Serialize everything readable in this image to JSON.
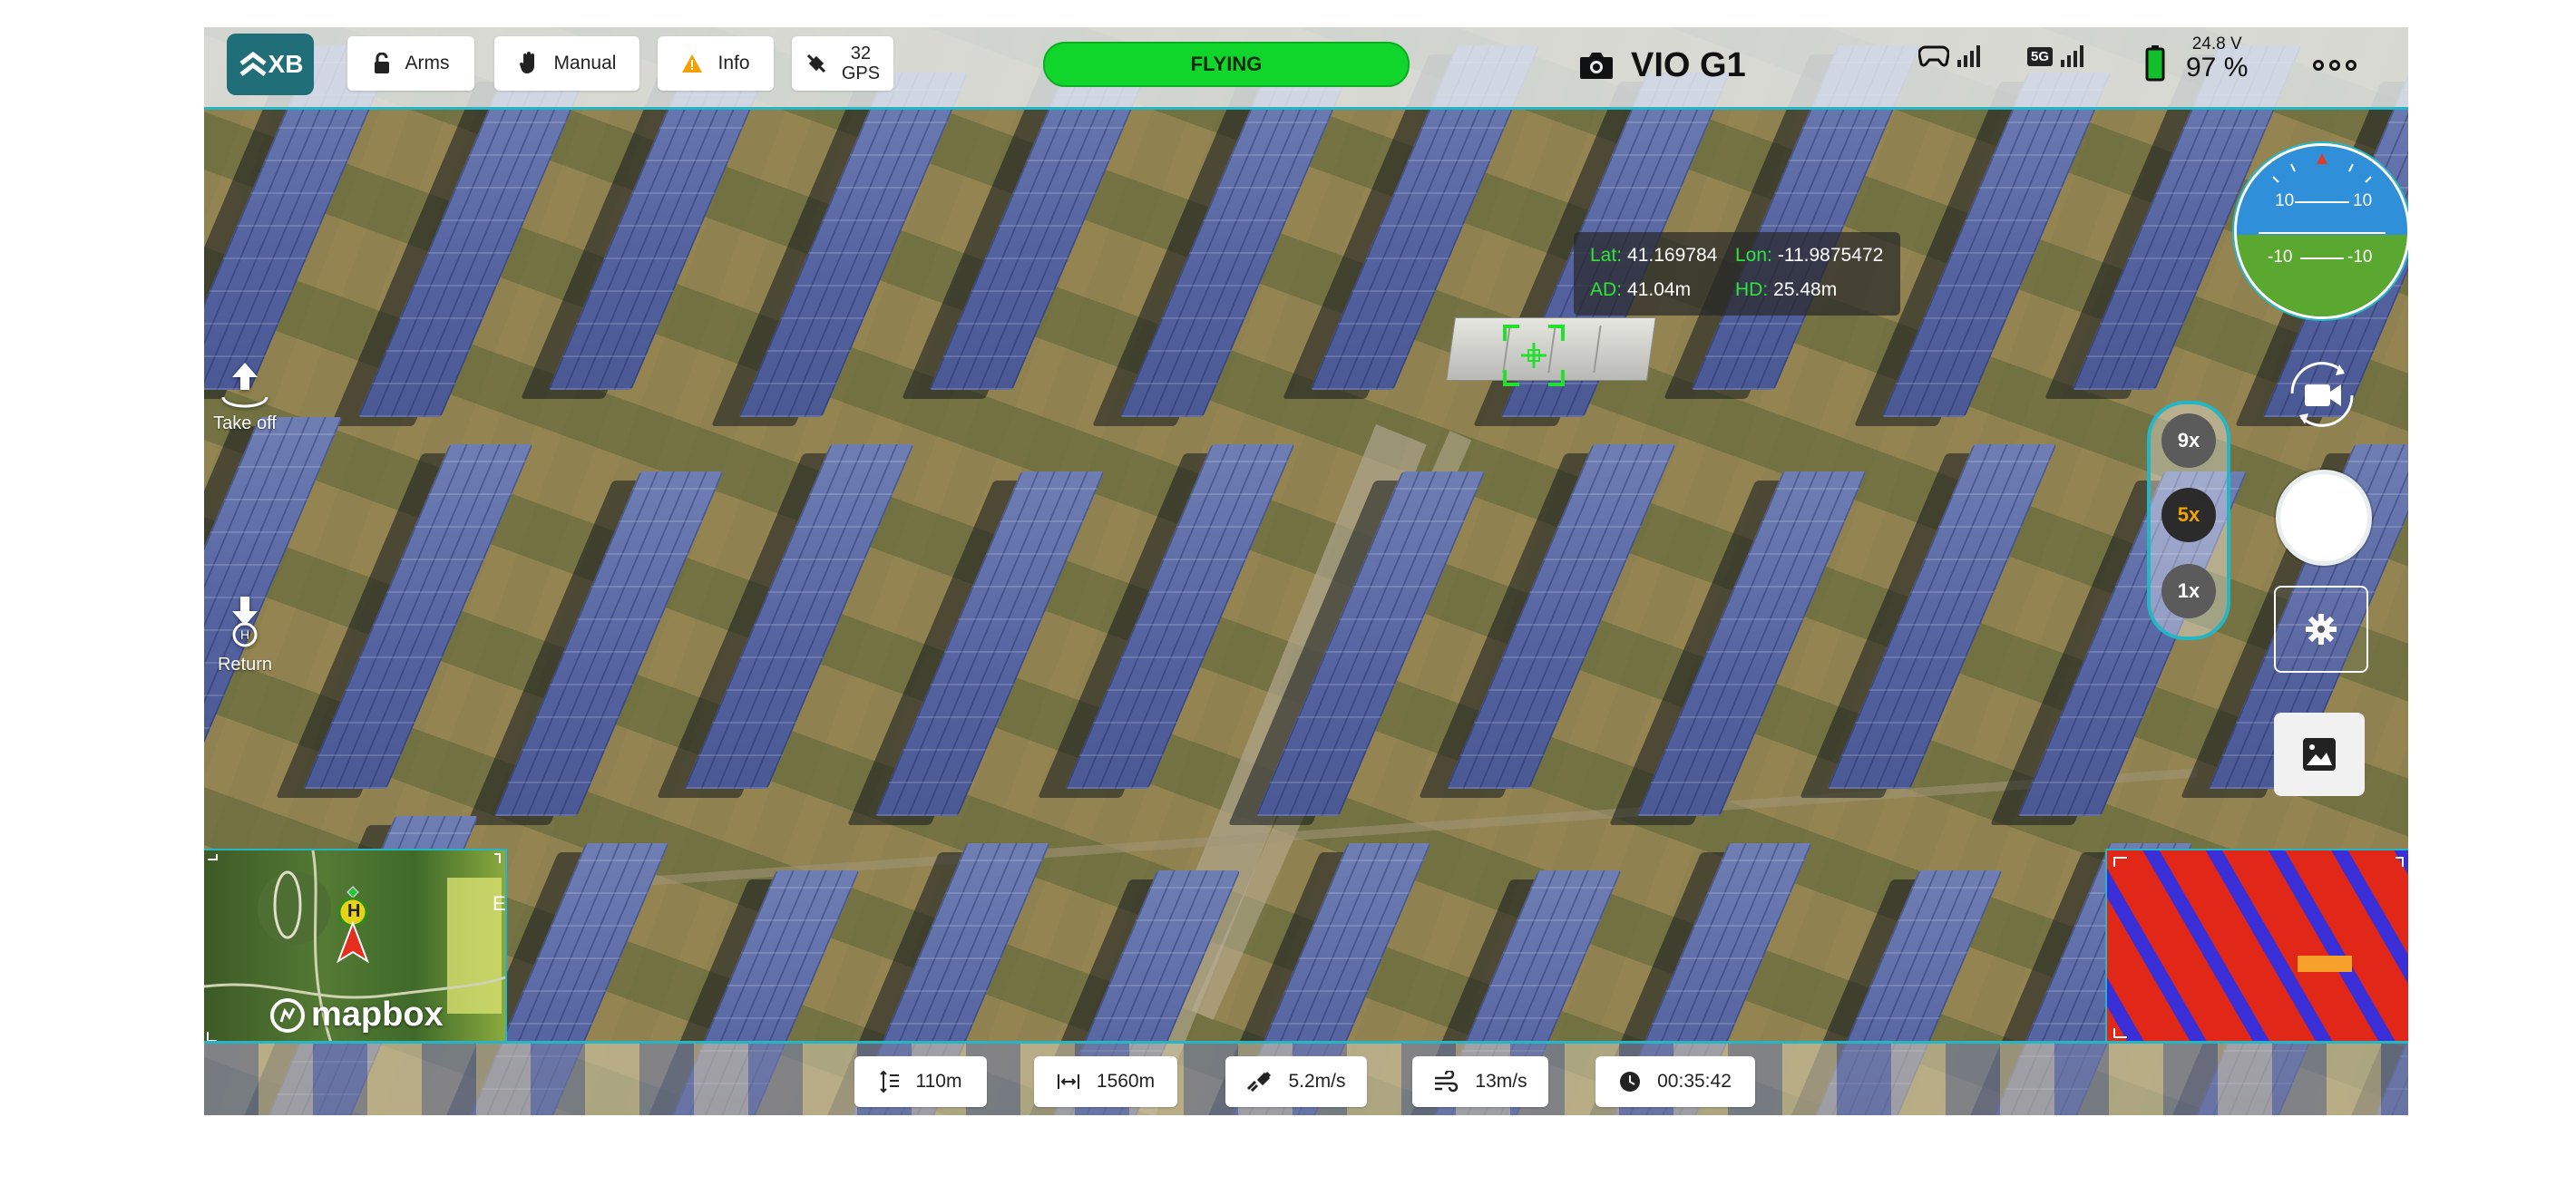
{
  "topbar": {
    "logo_text": "XB",
    "arms_label": "Arms",
    "mode_label": "Manual",
    "info_label": "Info",
    "gps_count": "32",
    "gps_label": "GPS",
    "status": "FLYING",
    "camera_name": "VIO G1",
    "battery_voltage": "24.8 V",
    "battery_percent": "97 %",
    "status_color": "#10d52b",
    "accent_color": "#23b7c5"
  },
  "side": {
    "takeoff_label": "Take off",
    "return_label": "Return"
  },
  "coords": {
    "lat_key": "Lat:",
    "lat_value": "41.169784",
    "lon_key": "Lon:",
    "lon_value": "-11.9875472",
    "ad_key": "AD:",
    "ad_value": "41.04m",
    "hd_key": "HD:",
    "hd_value": "25.48m"
  },
  "attitude": {
    "upper_left": "10",
    "upper_right": "10",
    "lower_left": "-10",
    "lower_right": "-10"
  },
  "zoom": {
    "options": [
      "9x",
      "5x",
      "1x"
    ],
    "active": "5x"
  },
  "minimap": {
    "brand": "mapbox",
    "marker_letter": "H",
    "edge_letter": "E"
  },
  "bottombar": {
    "altitude": "110m",
    "distance": "1560m",
    "speed": "5.2m/s",
    "wind": "13m/s",
    "flight_time": "00:35:42"
  }
}
